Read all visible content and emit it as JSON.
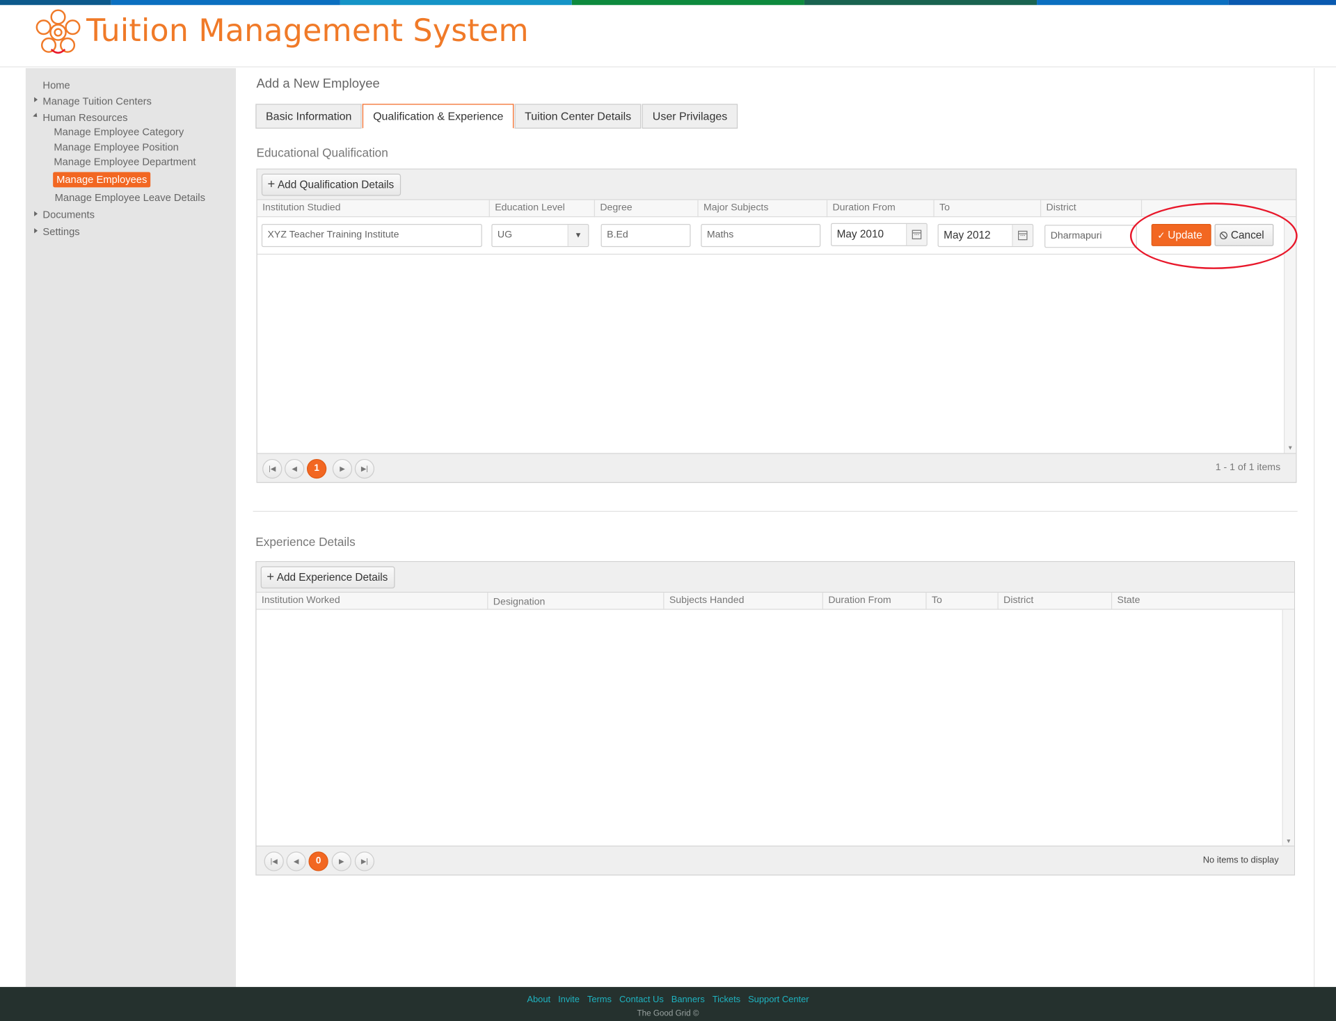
{
  "app": {
    "title": "Tuition Management System",
    "brand_color": "#f07a28",
    "accent_color": "#f26722",
    "top_stripe_colors": [
      "#0d5a8c",
      "#0b6fc0",
      "#1594c7",
      "#16a69c",
      "#0e8a3e",
      "#1a6350",
      "#0a5ab0"
    ]
  },
  "sidebar": {
    "items": [
      {
        "label": "Home",
        "expander": "none"
      },
      {
        "label": "Manage Tuition Centers",
        "expander": "collapsed"
      },
      {
        "label": "Human Resources",
        "expander": "expanded"
      },
      {
        "label": "Manage Employee Category",
        "expander": "none"
      },
      {
        "label": "Manage Employee Position",
        "expander": "none"
      },
      {
        "label": "Manage Employee Department",
        "expander": "none"
      },
      {
        "label": "Manage Employees",
        "expander": "none",
        "active": true
      },
      {
        "label": "Manage Employee Leave Details",
        "expander": "none"
      },
      {
        "label": "Documents",
        "expander": "collapsed"
      },
      {
        "label": "Settings",
        "expander": "collapsed"
      }
    ]
  },
  "page": {
    "title": "Add a New Employee",
    "tabs": [
      {
        "label": "Basic Information",
        "active": false
      },
      {
        "label": "Qualification & Experience",
        "active": true
      },
      {
        "label": "Tuition Center Details",
        "active": false
      },
      {
        "label": "User Privilages",
        "active": false
      }
    ]
  },
  "qualification": {
    "section_title": "Educational Qualification",
    "add_button": "Add Qualification Details",
    "columns": [
      "Institution Studied",
      "Education Level",
      "Degree",
      "Major Subjects",
      "Duration From",
      "To",
      "District"
    ],
    "edit_row": {
      "institution": "XYZ Teacher Training Institute",
      "education_level": "UG",
      "degree": "B.Ed",
      "major_subjects": "Maths",
      "duration_from": "May 2010",
      "to": "May 2012",
      "district": "Dharmapuri"
    },
    "update_button": "Update",
    "cancel_button": "Cancel",
    "pager": {
      "current_page": "1",
      "info": "1 - 1 of 1 items"
    }
  },
  "experience": {
    "section_title": "Experience Details",
    "add_button": "Add Experience Details",
    "columns": [
      "Institution Worked",
      "Designation",
      "Subjects Handed",
      "Duration From",
      "To",
      "District",
      "State"
    ],
    "pager": {
      "current_page": "0",
      "info": "No items to display"
    }
  },
  "footer": {
    "links": [
      "About",
      "Invite",
      "Terms",
      "Contact Us",
      "Banners",
      "Tickets",
      "Support Center"
    ],
    "copyright": "The Good Grid ©"
  }
}
